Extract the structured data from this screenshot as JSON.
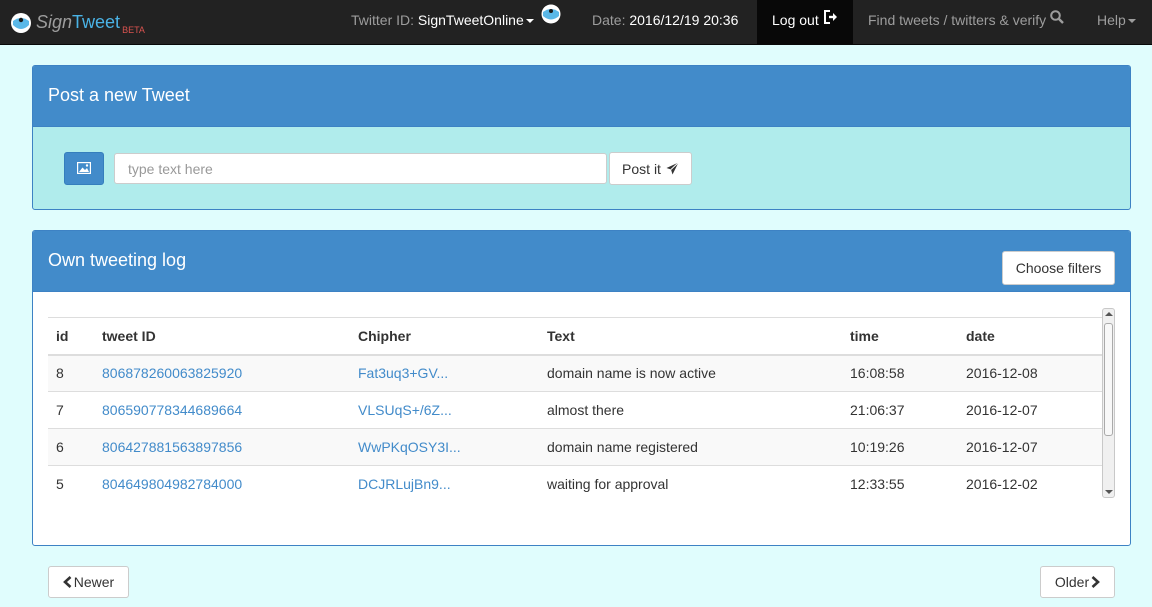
{
  "navbar": {
    "brand_sign": "Sign",
    "brand_tweet": "Tweet",
    "brand_beta": "BETA",
    "twitter_id_label": "Twitter ID: ",
    "twitter_id_value": "SignTweetOnline",
    "date_label": "Date: ",
    "date_value": "2016/12/19 20:36",
    "logout_label": "Log out",
    "find_label": "Find tweets / twitters & verify",
    "help_label": "Help"
  },
  "post_panel": {
    "title": "Post a new Tweet",
    "input_placeholder": "type text here",
    "post_label": "Post it"
  },
  "log_panel": {
    "title": "Own tweeting log",
    "filters_label": "Choose filters",
    "columns": [
      "id",
      "tweet ID",
      "Chipher",
      "Text",
      "time",
      "date"
    ],
    "rows": [
      {
        "id": "8",
        "tweet_id": "806878260063825920",
        "cipher": "Fat3uq3+GV...",
        "text": "domain name is now active",
        "time": "16:08:58",
        "date": "2016-12-08"
      },
      {
        "id": "7",
        "tweet_id": "806590778344689664",
        "cipher": "VLSUqS+/6Z...",
        "text": "almost there",
        "time": "21:06:37",
        "date": "2016-12-07"
      },
      {
        "id": "6",
        "tweet_id": "806427881563897856",
        "cipher": "WwPKqOSY3I...",
        "text": "domain name registered",
        "time": "10:19:26",
        "date": "2016-12-07"
      },
      {
        "id": "5",
        "tweet_id": "804649804982784000",
        "cipher": "DCJRLujBn9...",
        "text": "waiting for approval",
        "time": "12:33:55",
        "date": "2016-12-02"
      }
    ]
  },
  "pager": {
    "newer_label": "Newer",
    "older_label": "Older"
  },
  "colors": {
    "navbar_bg": "#222222",
    "panel_heading": "#428bca",
    "page_bg": "#e0fdfd",
    "post_body_bg": "#b0ecec",
    "link": "#428bca"
  }
}
